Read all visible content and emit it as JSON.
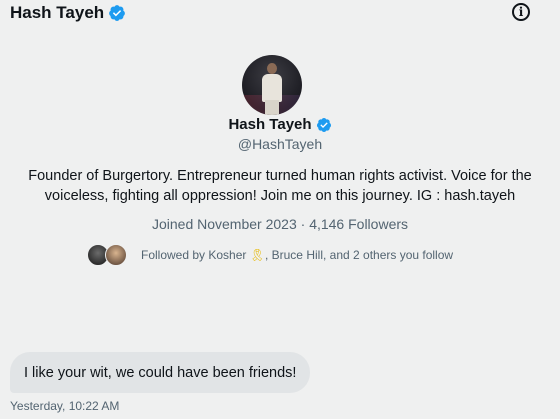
{
  "header": {
    "name": "Hash Tayeh",
    "verified_icon": "verified-badge-icon",
    "info_icon": "info-icon",
    "info_glyph": "i"
  },
  "profile": {
    "name": "Hash Tayeh",
    "handle": "@HashTayeh",
    "bio": "Founder of Burgertory. Entrepreneur turned human rights activist. Voice for the voiceless, fighting all oppression! Join me on this journey. IG : hash.tayeh",
    "joined": "Joined November 2023",
    "separator": " · ",
    "followers": "4,146 Followers",
    "followed_by_prefix": "Followed by Kosher",
    "followed_by_emoji": "🎗",
    "followed_by_suffix": ", Bruce Hill, and 2 others you follow"
  },
  "conversation": {
    "messages": [
      {
        "text": "I like your wit, we could have been friends!",
        "timestamp": "Yesterday, 10:22 AM"
      }
    ]
  },
  "colors": {
    "background": "#eff0f0",
    "verified_blue": "#1d9bf0",
    "secondary_text": "#536471",
    "bubble": "#e1e4e6"
  }
}
